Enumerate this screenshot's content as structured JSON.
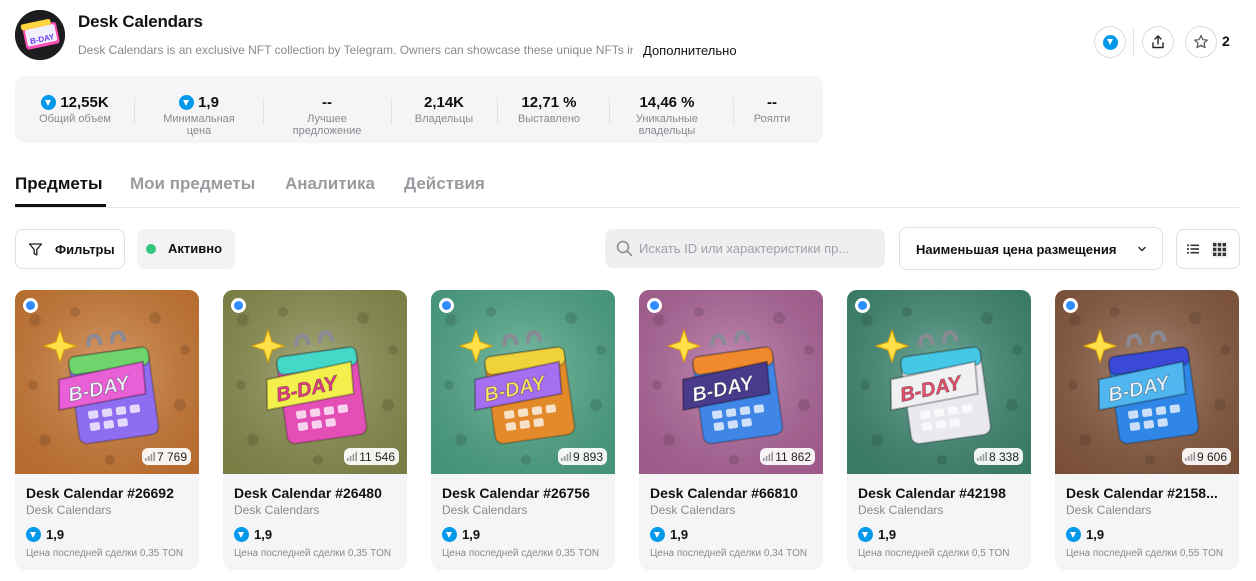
{
  "collection": {
    "title": "Desk Calendars",
    "description": "Desk Calendars is an exclusive NFT collection by Telegram. Owners can showcase these unique NFTs in",
    "more_label": "Дополнительно",
    "logo_text": "B-DAY",
    "favorites_count": "2"
  },
  "header_icons": [
    "ton-icon",
    "share-icon",
    "star-icon"
  ],
  "stats": [
    {
      "value": "12,55K",
      "label": "Общий объем",
      "ton": true
    },
    {
      "value": "1,9",
      "label": "Минимальная цена",
      "ton": true
    },
    {
      "value": "--",
      "label": "Лучшее предложение",
      "ton": false
    },
    {
      "value": "2,14K",
      "label": "Владельцы",
      "ton": false
    },
    {
      "value": "12,71 %",
      "label": "Выставлено",
      "ton": false
    },
    {
      "value": "14,46 %",
      "label": "Уникальные владельцы",
      "ton": false
    },
    {
      "value": "--",
      "label": "Роялти",
      "ton": false
    }
  ],
  "tabs": [
    {
      "label": "Предметы",
      "active": true
    },
    {
      "label": "Мои предметы",
      "active": false
    },
    {
      "label": "Аналитика",
      "active": false
    },
    {
      "label": "Действия",
      "active": false
    }
  ],
  "toolbar": {
    "filters_label": "Фильтры",
    "active_label": "Активно",
    "search_placeholder": "Искать ID или характеристики пр...",
    "sort_label": "Наименьшая цена размещения"
  },
  "cards": [
    {
      "name": "Desk Calendar #26692",
      "collection": "Desk Calendars",
      "price": "1,9",
      "count": "7 769",
      "last_sale": "Цена последней сделки 0,35 TON",
      "bg": "#cf7a34",
      "page": "#e85fd6",
      "tab": "#6ed46b",
      "body": "#8f6df0",
      "text": "#f4f4ff"
    },
    {
      "name": "Desk Calendar #26480",
      "collection": "Desk Calendars",
      "price": "1,9",
      "count": "11 546",
      "last_sale": "Цена последней сделки 0,35 TON",
      "bg": "#8a8f4e",
      "page": "#f3f04d",
      "tab": "#43d8c8",
      "body": "#e44fb7",
      "text": "#e43d8c"
    },
    {
      "name": "Desk Calendar #26756",
      "collection": "Desk Calendars",
      "price": "1,9",
      "count": "9 893",
      "last_sale": "Цена последней сделки 0,35 TON",
      "bg": "#4ea888",
      "page": "#a66ef0",
      "tab": "#f0d23b",
      "body": "#e38a2a",
      "text": "#ffe46a"
    },
    {
      "name": "Desk Calendar #66810",
      "collection": "Desk Calendars",
      "price": "1,9",
      "count": "11 862",
      "last_sale": "Цена последней сделки 0,34 TON",
      "bg": "#b2669c",
      "page": "#4a3a8c",
      "tab": "#f08a2c",
      "body": "#3f86e6",
      "text": "#ffffff"
    },
    {
      "name": "Desk Calendar #42198",
      "collection": "Desk Calendars",
      "price": "1,9",
      "count": "8 338",
      "last_sale": "Цена последней сделки 0,5 TON",
      "bg": "#3f8a73",
      "page": "#f1f1f4",
      "tab": "#44c8e6",
      "body": "#e9e9ef",
      "text": "#e8506a"
    },
    {
      "name": "Desk Calendar #2158...",
      "collection": "Desk Calendars",
      "price": "1,9",
      "count": "9 606",
      "last_sale": "Цена последней сделки 0,55 TON",
      "bg": "#8a5a3e",
      "page": "#4fb6f0",
      "tab": "#3b4ad6",
      "body": "#2f86e6",
      "text": "#e6f6ff"
    }
  ],
  "colors": {
    "accent": "#0098ea",
    "active_dot": "#34c77b",
    "verified": "#2f8cff"
  }
}
